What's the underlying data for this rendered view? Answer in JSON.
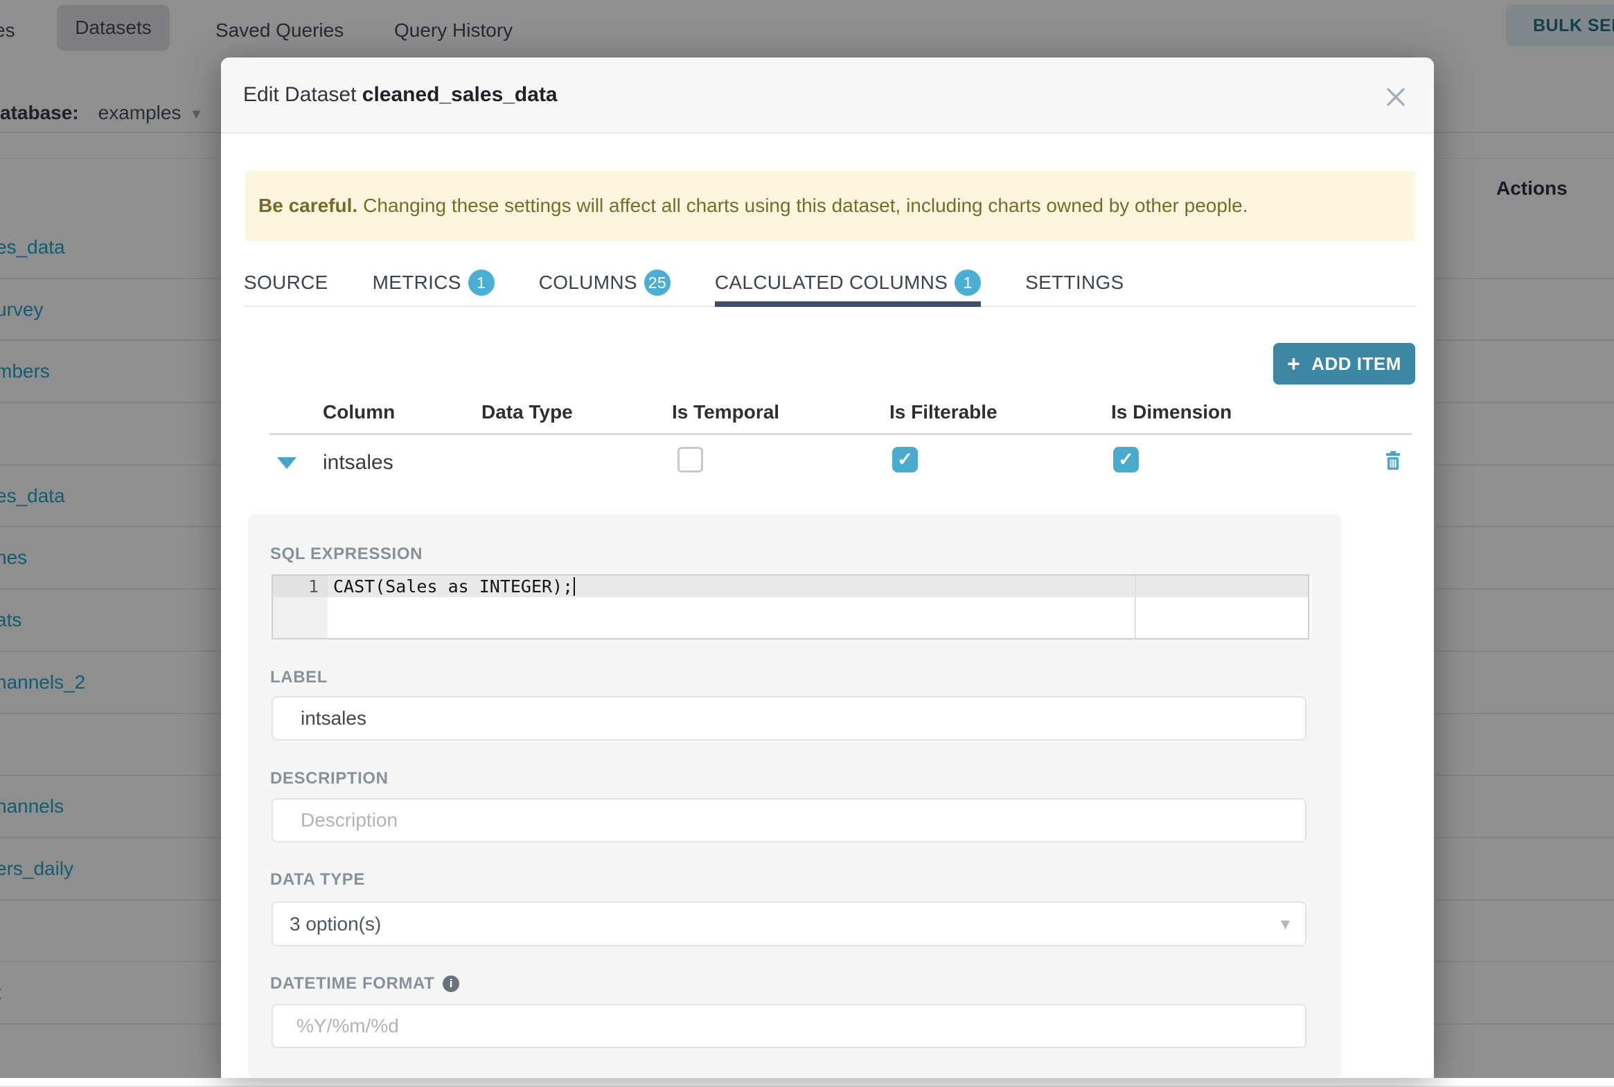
{
  "background": {
    "nav": {
      "item_cut": "es",
      "datasets": "Datasets",
      "saved_queries": "Saved Queries",
      "query_history": "Query History",
      "bulk_select_label": "BULK SELECT"
    },
    "database_bar": {
      "label": "atabase:",
      "value": "examples"
    },
    "table": {
      "actions_header": "Actions",
      "rows": [
        "es_data",
        "urvey",
        "mbers",
        "",
        "es_data",
        "nes",
        "ats",
        "nannels_2",
        "",
        "hannels",
        "ers_daily",
        "",
        "t",
        ""
      ]
    }
  },
  "modal": {
    "title_prefix": "Edit Dataset ",
    "title_name": "cleaned_sales_data",
    "close_icon": "close-x",
    "warning": {
      "bold": "Be careful.",
      "text": "Changing these settings will affect all charts using this dataset, including charts owned by other people."
    },
    "tabs": [
      {
        "label": "SOURCE"
      },
      {
        "label": "METRICS",
        "badge": "1"
      },
      {
        "label": "COLUMNS",
        "badge": "25"
      },
      {
        "label": "CALCULATED COLUMNS",
        "badge": "1",
        "active": true
      },
      {
        "label": "SETTINGS"
      }
    ],
    "add_item_label": "ADD ITEM",
    "columns_table": {
      "headers": [
        "Column",
        "Data Type",
        "Is Temporal",
        "Is Filterable",
        "Is Dimension"
      ],
      "row": {
        "column": "intsales",
        "is_temporal": false,
        "is_filterable": true,
        "is_dimension": true
      },
      "check_glyph": "✓"
    },
    "detail": {
      "sql_label": "SQL EXPRESSION",
      "sql_line_number": "1",
      "sql_code": "CAST(Sales as INTEGER);",
      "label_label": "LABEL",
      "label_value": "intsales",
      "description_label": "DESCRIPTION",
      "description_placeholder": "Description",
      "datatype_label": "DATA TYPE",
      "datatype_value": "3 option(s)",
      "datetime_label": "DATETIME FORMAT",
      "datetime_info": "i",
      "datetime_placeholder": "%Y/%m/%d"
    },
    "colors": {
      "accent_teal": "#3b87a4",
      "accent_cyan": "#4aabce",
      "tab_underline": "#414e6b",
      "banner_bg": "#fcf6de",
      "link": "#20a7c9"
    }
  }
}
